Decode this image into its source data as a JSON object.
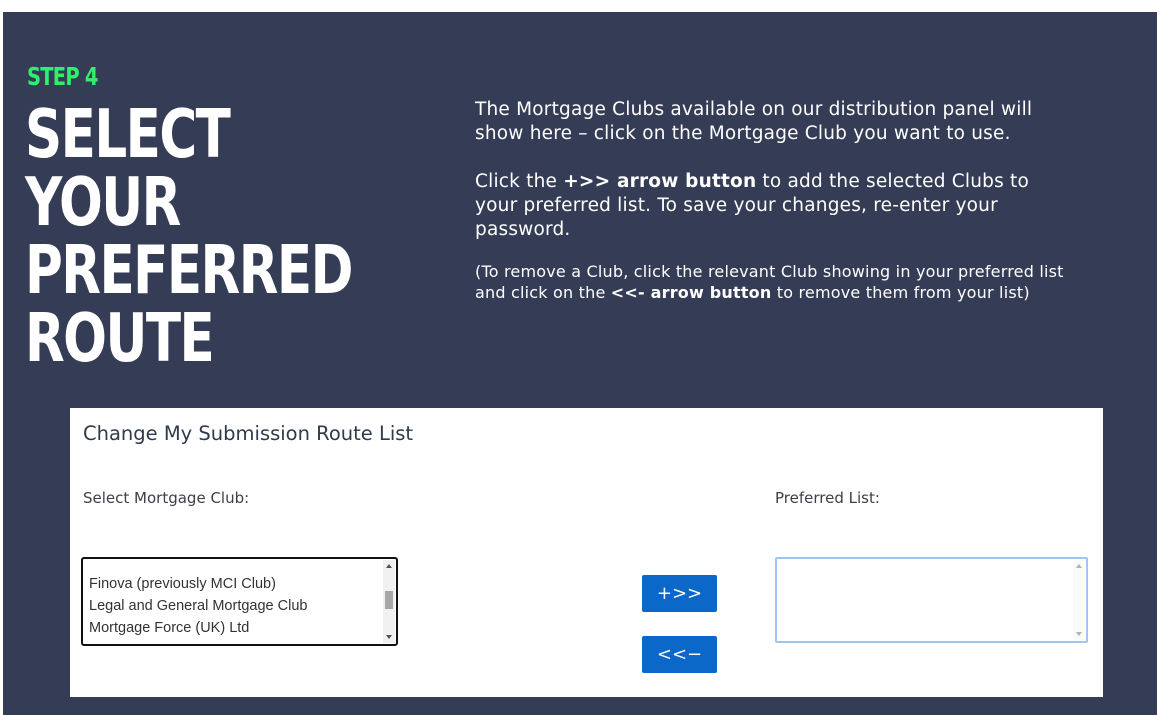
{
  "step_label": "STEP 4",
  "heading": "SELECT YOUR PREFERRED ROUTE",
  "intro": {
    "p1": "The Mortgage Clubs available on our distribution panel will show here – click on the Mortgage Club you want to use.",
    "p2_before": "Click the ",
    "p2_bold": "+>> arrow button",
    "p2_after": " to add the selected Clubs to your preferred list. To save your changes, re-enter your password.",
    "p3_before": "(To remove a Club, click the relevant Club showing in your preferred list and click on the ",
    "p3_bold": "<<- arrow button",
    "p3_after": " to remove them from your list)"
  },
  "form": {
    "title": "Change My Submission Route List",
    "select_label": "Select Mortgage Club:",
    "preferred_label": "Preferred List:",
    "clubs": [
      "Finova (previously MCI Club)",
      "Legal and General Mortgage Club",
      "Mortgage Force (UK) Ltd"
    ],
    "preferred_items": [],
    "add_button": "+>>",
    "remove_button": "<<−"
  },
  "colors": {
    "panel_bg": "#353c56",
    "step_green": "#2ff06a",
    "button_blue": "#0b68c8",
    "preferred_border": "#9ec6f0"
  }
}
